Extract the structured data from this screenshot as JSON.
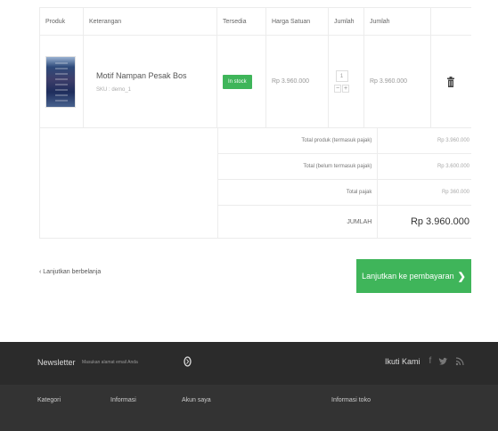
{
  "cart": {
    "headers": {
      "product": "Produk",
      "description": "Keterangan",
      "availability": "Tersedia",
      "unit_price": "Harga Satuan",
      "quantity": "Jumlah",
      "total": "Jumlah"
    },
    "item": {
      "name": "Motif Nampan Pesak Bos",
      "sku": "SKU : demo_1",
      "availability": "In stock",
      "unit_price": "Rp 3.960.000",
      "quantity": "1",
      "minus": "−",
      "plus": "+",
      "total": "Rp 3.960.000"
    },
    "summary": {
      "products_incl_tax_label": "Total produk (termasuk pajak)",
      "products_incl_tax_value": "Rp 3.960.000",
      "excl_tax_label": "Total (belum termasuk pajak)",
      "excl_tax_value": "Rp 3.600.000",
      "tax_label": "Total pajak",
      "tax_value": "Rp 360.000",
      "grand_label": "JUMLAH",
      "grand_value": "Rp 3.960.000"
    }
  },
  "actions": {
    "continue": "Lanjutkan berbelanja",
    "checkout": "Lanjutkan ke pembayaran",
    "checkout_arrow": "❯"
  },
  "footer": {
    "newsletter_label": "Newsletter",
    "newsletter_placeholder": "Masukan alamat email Anda",
    "follow_label": "Ikuti Kami",
    "social_icons": [
      "facebook-icon",
      "twitter-icon",
      "rss-icon"
    ],
    "columns": [
      "Kategori",
      "Informasi",
      "Akun saya",
      "Informasi toko"
    ]
  },
  "colors": {
    "accent_green": "#3fb55a",
    "footer_dark": "#2b2b2b",
    "footer_darker": "#333333"
  }
}
